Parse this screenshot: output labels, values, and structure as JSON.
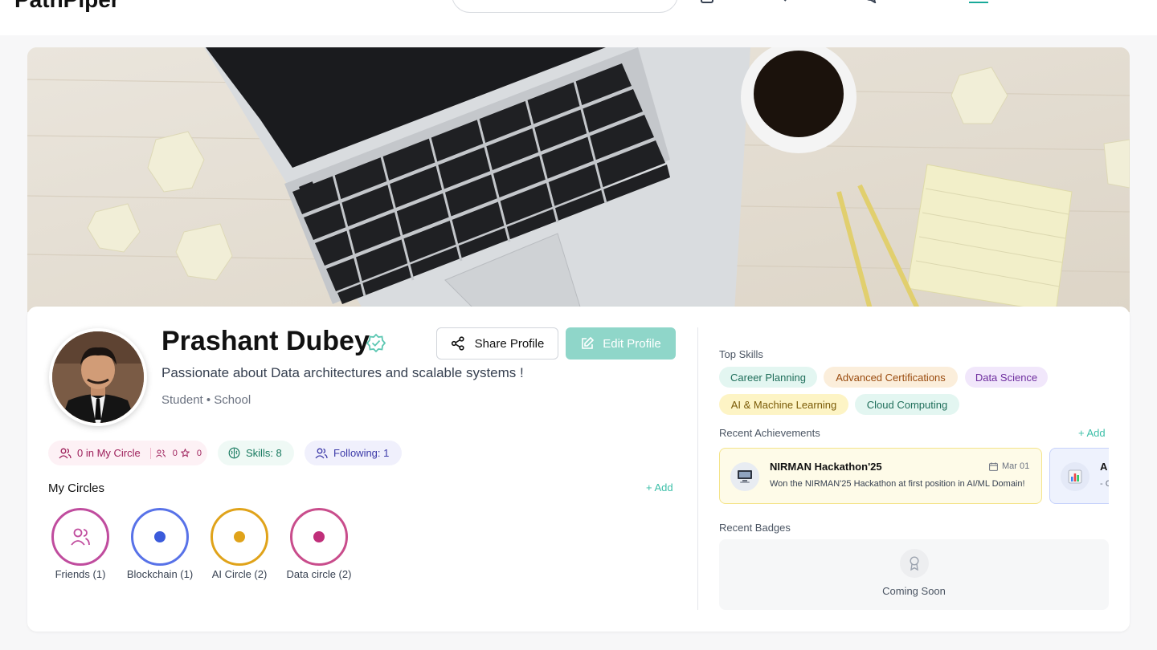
{
  "app": {
    "brand": "PathPiper"
  },
  "profile": {
    "name": "Prashant Dubey",
    "bio": "Passionate about Data architectures and scalable systems !",
    "meta": "Student • School",
    "share_label": "Share Profile",
    "edit_label": "Edit Profile"
  },
  "stats": {
    "circle_label": "0 in My Circle",
    "circle_count": "0",
    "star_count": "0",
    "skills_label": "Skills: 8",
    "following_label": "Following: 1"
  },
  "circles": {
    "title": "My Circles",
    "add_label": "+ Add",
    "items": [
      {
        "label": "Friends (1)",
        "color": "#c04c9e",
        "icon": "users-icon"
      },
      {
        "label": "Blockchain (1)",
        "color": "#3b5bdb",
        "icon": "dot"
      },
      {
        "label": "AI Circle (2)",
        "color": "#e0a31a",
        "icon": "dot"
      },
      {
        "label": "Data circle (2)",
        "color": "#c02f7a",
        "icon": "dot"
      }
    ]
  },
  "skills": {
    "title": "Top Skills",
    "items": [
      {
        "label": "Career Planning",
        "bg": "#e3f6f1",
        "fg": "#1f6e5a"
      },
      {
        "label": "Advanced Certifications",
        "bg": "#fbeedb",
        "fg": "#9a4b0e"
      },
      {
        "label": "Data Science",
        "bg": "#f1e7fb",
        "fg": "#6d2c9e"
      },
      {
        "label": "AI & Machine Learning",
        "bg": "#fdf4c5",
        "fg": "#7a5a06"
      },
      {
        "label": "Cloud Computing",
        "bg": "#e3f6f1",
        "fg": "#1f6e5a"
      }
    ]
  },
  "achievements": {
    "title": "Recent Achievements",
    "add_label": "+ Add",
    "items": [
      {
        "title": "NIRMAN Hackathon'25",
        "date": "Mar 01",
        "desc": "Won the NIRMAN'25 Hackathon at first position in AI/ML Domain!",
        "icon": "computer-icon"
      },
      {
        "title": "A",
        "desc": "- C",
        "icon": "bar-chart-icon"
      }
    ]
  },
  "badges": {
    "title": "Recent Badges",
    "empty_label": "Coming Soon"
  }
}
